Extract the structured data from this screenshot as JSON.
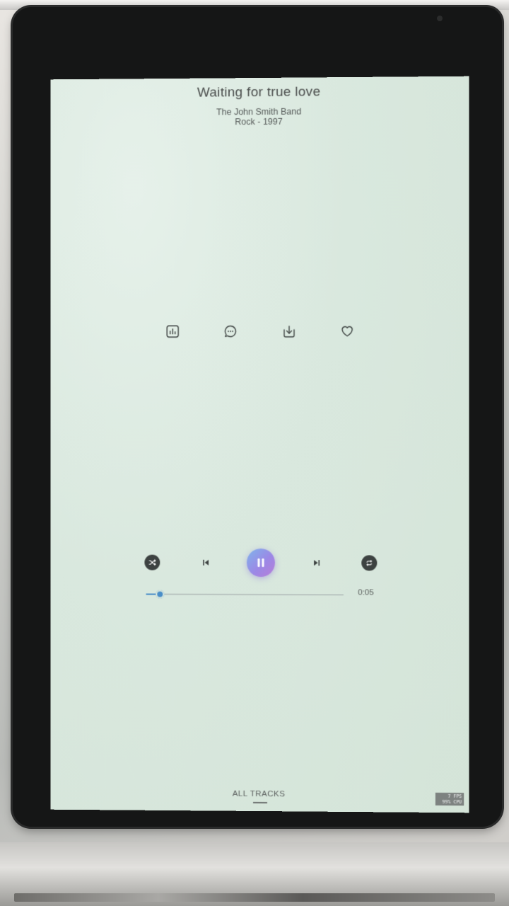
{
  "now_playing": {
    "title": "Waiting for true love",
    "artist": "The John Smith Band",
    "genre_year": "Rock - 1997"
  },
  "actions": [
    {
      "name": "equalizer",
      "icon": "bar-chart-icon"
    },
    {
      "name": "comments",
      "icon": "chat-bubble-icon"
    },
    {
      "name": "download",
      "icon": "download-icon"
    },
    {
      "name": "favorite",
      "icon": "heart-icon"
    }
  ],
  "player": {
    "elapsed": "0:05",
    "progress_percent": 7,
    "accent_color": "#4a8ec8"
  },
  "nav": {
    "tab_label": "ALL TRACKS"
  },
  "perf": {
    "fps": "7 FPS",
    "cpu": "99% CPU"
  }
}
